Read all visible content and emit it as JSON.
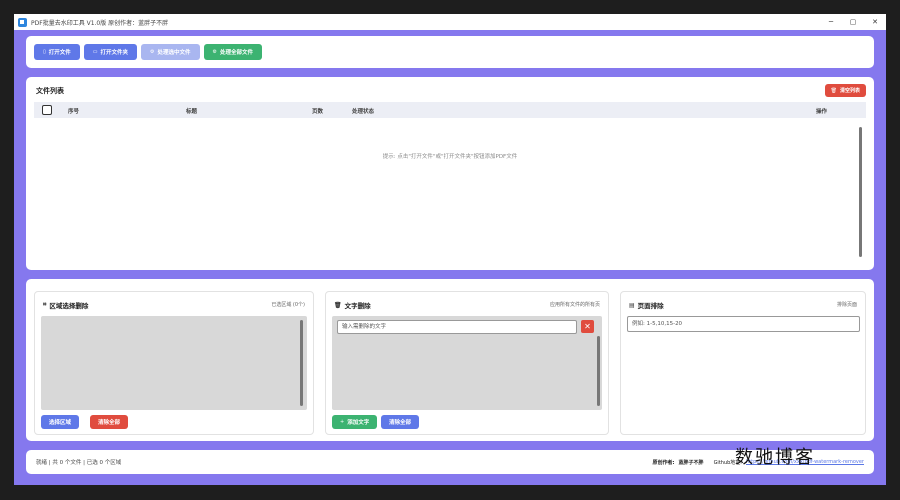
{
  "window": {
    "title": "PDF批量去水印工具 V1.0版    原创作者：蓝胖子不胖",
    "controls": {
      "minimize": "─",
      "maximize": "▢",
      "close": "✕"
    }
  },
  "toolbar": {
    "open_file": "打开文件",
    "open_folder": "打开文件夹",
    "process_selected": "处理选中文件",
    "process_all": "处理全部文件"
  },
  "file_list": {
    "title": "文件列表",
    "clear_button": "清空列表",
    "columns": [
      "序号",
      "标题",
      "页数",
      "处理状态",
      "操作"
    ],
    "hint": "提示: 点击\"打开文件\"或\"打开文件夹\"按钮添加PDF文件"
  },
  "region_panel": {
    "title": "区域选择删除",
    "note": "已选区域 (0个)",
    "select_button": "选择区域",
    "clear_button": "清除全部"
  },
  "text_panel": {
    "title": "文字删除",
    "note": "应用所有文件的所有页",
    "input_placeholder": "输入需删除的文字",
    "add_button": "添加文字",
    "clear_button": "清除全部"
  },
  "page_panel": {
    "title": "页面排除",
    "note": "排除页面",
    "input_placeholder": "例如: 1-5,10,15-20"
  },
  "status": {
    "left": "就绪 | 共 0 个文件 | 已选 0 个区域",
    "author_label": "原创作者:",
    "author_name": "蓝胖子不胖",
    "github_label": "Github地址:",
    "github_link": "https://github.com/xxx/pdf-watermark-remover"
  },
  "watermark": "数驰博客",
  "colors": {
    "accent": "#5f78e8",
    "background": "#8578ee",
    "success": "#3cb371",
    "danger": "#e04c3e"
  }
}
